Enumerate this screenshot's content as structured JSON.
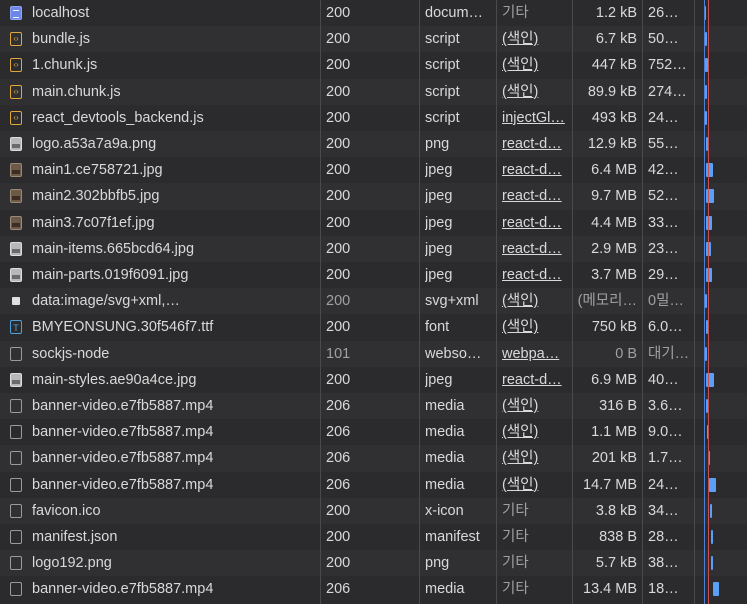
{
  "requests": [
    {
      "name": "localhost",
      "status": "200",
      "type": "docum…",
      "initiator": "기타",
      "initiator_link": false,
      "size": "1.2 kB",
      "time": "26…",
      "icon": "document-icon",
      "waterfall": [
        0.1,
        0.14
      ]
    },
    {
      "name": "bundle.js",
      "status": "200",
      "type": "script",
      "initiator": "(색인)",
      "initiator_link": true,
      "size": "6.7 kB",
      "time": "50…",
      "icon": "script-icon",
      "waterfall": [
        0.12,
        0.17
      ]
    },
    {
      "name": "1.chunk.js",
      "status": "200",
      "type": "script",
      "initiator": "(색인)",
      "initiator_link": true,
      "size": "447 kB",
      "time": "752…",
      "icon": "script-icon",
      "waterfall": [
        0.12,
        0.19
      ]
    },
    {
      "name": "main.chunk.js",
      "status": "200",
      "type": "script",
      "initiator": "(색인)",
      "initiator_link": true,
      "size": "89.9 kB",
      "time": "274…",
      "icon": "script-icon",
      "waterfall": [
        0.12,
        0.17
      ]
    },
    {
      "name": "react_devtools_backend.js",
      "status": "200",
      "type": "script",
      "initiator": "injectGl…",
      "initiator_link": true,
      "size": "493 kB",
      "time": "24…",
      "icon": "script-icon",
      "waterfall": [
        0.12,
        0.16
      ]
    },
    {
      "name": "logo.a53a7a9a.png",
      "status": "200",
      "type": "png",
      "initiator": "react-d…",
      "initiator_link": true,
      "size": "12.9 kB",
      "time": "55…",
      "icon": "image-icon",
      "waterfall": [
        0.14,
        0.18
      ]
    },
    {
      "name": "main1.ce758721.jpg",
      "status": "200",
      "type": "jpeg",
      "initiator": "react-d…",
      "initiator_link": true,
      "size": "6.4 MB",
      "time": "42…",
      "icon": "photo-icon",
      "waterfall": [
        0.14,
        0.3
      ]
    },
    {
      "name": "main2.302bbfb5.jpg",
      "status": "200",
      "type": "jpeg",
      "initiator": "react-d…",
      "initiator_link": true,
      "size": "9.7 MB",
      "time": "52…",
      "icon": "photo-icon",
      "waterfall": [
        0.14,
        0.32
      ]
    },
    {
      "name": "main3.7c07f1ef.jpg",
      "status": "200",
      "type": "jpeg",
      "initiator": "react-d…",
      "initiator_link": true,
      "size": "4.4 MB",
      "time": "33…",
      "icon": "photo-icon",
      "waterfall": [
        0.14,
        0.28
      ]
    },
    {
      "name": "main-items.665bcd64.jpg",
      "status": "200",
      "type": "jpeg",
      "initiator": "react-d…",
      "initiator_link": true,
      "size": "2.9 MB",
      "time": "23…",
      "icon": "image-icon",
      "waterfall": [
        0.14,
        0.26
      ]
    },
    {
      "name": "main-parts.019f6091.jpg",
      "status": "200",
      "type": "jpeg",
      "initiator": "react-d…",
      "initiator_link": true,
      "size": "3.7 MB",
      "time": "29…",
      "icon": "image-icon",
      "waterfall": [
        0.14,
        0.27
      ]
    },
    {
      "name": "data:image/svg+xml,…",
      "status": "200",
      "type": "svg+xml",
      "initiator": "(색인)",
      "initiator_link": true,
      "size": "(메모리…",
      "time": "0밀…",
      "icon": "svg-icon",
      "waterfall": [
        0.12,
        0.14
      ],
      "muted": true
    },
    {
      "name": "BMYEONSUNG.30f546f7.ttf",
      "status": "200",
      "type": "font",
      "initiator": "(색인)",
      "initiator_link": true,
      "size": "750 kB",
      "time": "6.0…",
      "icon": "font-icon",
      "waterfall": [
        0.14,
        0.17
      ]
    },
    {
      "name": "sockjs-node",
      "status": "101",
      "type": "webso…",
      "initiator": "webpa…",
      "initiator_link": true,
      "size": "0 B",
      "time": "대기…",
      "icon": "blank-file-icon",
      "waterfall": [
        0.12,
        0.13
      ],
      "muted": true
    },
    {
      "name": "main-styles.ae90a4ce.jpg",
      "status": "200",
      "type": "jpeg",
      "initiator": "react-d…",
      "initiator_link": true,
      "size": "6.9 MB",
      "time": "40…",
      "icon": "image-icon",
      "waterfall": [
        0.14,
        0.31
      ]
    },
    {
      "name": "banner-video.e7fb5887.mp4",
      "status": "206",
      "type": "media",
      "initiator": "(색인)",
      "initiator_link": true,
      "size": "316 B",
      "time": "3.6…",
      "icon": "blank-file-icon",
      "waterfall": [
        0.14,
        0.17
      ]
    },
    {
      "name": "banner-video.e7fb5887.mp4",
      "status": "206",
      "type": "media",
      "initiator": "(색인)",
      "initiator_link": true,
      "size": "1.1 MB",
      "time": "9.0…",
      "icon": "blank-file-icon",
      "waterfall": [
        0.16,
        0.2
      ]
    },
    {
      "name": "banner-video.e7fb5887.mp4",
      "status": "206",
      "type": "media",
      "initiator": "(색인)",
      "initiator_link": true,
      "size": "201 kB",
      "time": "1.7…",
      "icon": "blank-file-icon",
      "waterfall": [
        0.18,
        0.21
      ]
    },
    {
      "name": "banner-video.e7fb5887.mp4",
      "status": "206",
      "type": "media",
      "initiator": "(색인)",
      "initiator_link": true,
      "size": "14.7 MB",
      "time": "24…",
      "icon": "blank-file-icon",
      "waterfall": [
        0.2,
        0.36
      ]
    },
    {
      "name": "favicon.ico",
      "status": "200",
      "type": "x-icon",
      "initiator": "기타",
      "initiator_link": false,
      "size": "3.8 kB",
      "time": "34…",
      "icon": "blank-file-icon",
      "waterfall": [
        0.22,
        0.26
      ]
    },
    {
      "name": "manifest.json",
      "status": "200",
      "type": "manifest",
      "initiator": "기타",
      "initiator_link": false,
      "size": "838 B",
      "time": "28…",
      "icon": "blank-file-icon",
      "waterfall": [
        0.24,
        0.28
      ]
    },
    {
      "name": "logo192.png",
      "status": "200",
      "type": "png",
      "initiator": "기타",
      "initiator_link": false,
      "size": "5.7 kB",
      "time": "38…",
      "icon": "blank-file-icon",
      "waterfall": [
        0.24,
        0.29
      ]
    },
    {
      "name": "banner-video.e7fb5887.mp4",
      "status": "206",
      "type": "media",
      "initiator": "기타",
      "initiator_link": false,
      "size": "13.4 MB",
      "time": "18…",
      "icon": "blank-file-icon",
      "waterfall": [
        0.3,
        0.42
      ]
    }
  ],
  "colors": {
    "waterfall_bar": "#5ba0f5",
    "load_event_line": "#c85050",
    "dom_content_line": "#4c7fd6"
  }
}
